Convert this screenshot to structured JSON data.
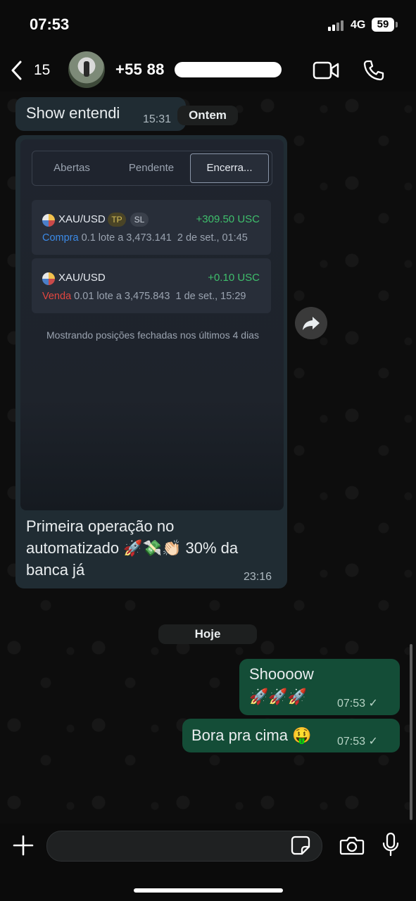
{
  "status_bar": {
    "time": "07:53",
    "network": "4G",
    "battery": "59"
  },
  "header": {
    "back_count": "15",
    "contact_name": "+55 88"
  },
  "messages": [
    {
      "text": "Show entendi",
      "time": "15:31"
    },
    {
      "caption": "Primeira operação no automatizado 🚀💸👏🏻 30% da banca já",
      "caption_line1": "Primeira operação no",
      "caption_line2": "automatizado 🚀💸👏🏻 30% da",
      "caption_line3": "banca já",
      "time": "23:16"
    },
    {
      "text_line1": "Shoooow",
      "text_line2": "🚀🚀🚀",
      "time": "07:53",
      "status": "✓"
    },
    {
      "text": "Bora pra cima 🤑",
      "time": "07:53",
      "status": "✓"
    }
  ],
  "day_separators": {
    "yesterday": "Ontem",
    "today": "Hoje"
  },
  "screenshot": {
    "tabs": [
      "Abertas",
      "Pendente",
      "Encerra..."
    ],
    "active_tab": "Encerra...",
    "positions": [
      {
        "symbol": "XAU/USD",
        "tags": [
          "TP",
          "SL"
        ],
        "pnl": "+309.50 USC",
        "side": "Compra",
        "details": "0.1 lote a 3,473.141",
        "date": "2 de set., 01:45"
      },
      {
        "symbol": "XAU/USD",
        "tags": [],
        "pnl": "+0.10 USC",
        "side": "Venda",
        "details": "0.01 lote a 3,475.843",
        "date": "1 de set., 15:29"
      }
    ],
    "footer_note": "Mostrando posições fechadas nos últimos 4 dias"
  },
  "colors": {
    "incoming_bubble": "#202c33",
    "outgoing_bubble": "#144d37",
    "profit": "#3fbf6c",
    "buy": "#3c8be8",
    "sell": "#e2463f"
  },
  "icons": [
    "back-chevron-icon",
    "video-call-icon",
    "phone-icon",
    "forward-icon",
    "plus-icon",
    "sticker-icon",
    "camera-icon",
    "microphone-icon"
  ]
}
